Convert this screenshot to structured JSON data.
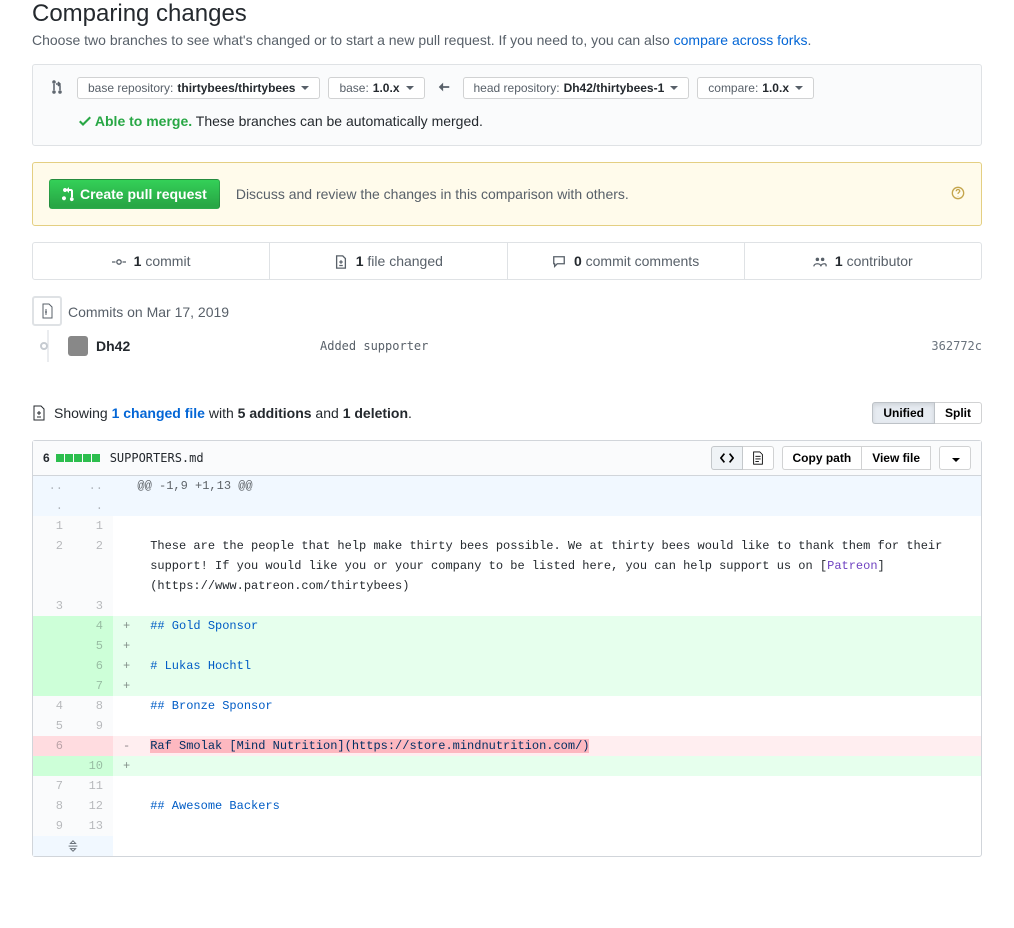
{
  "page": {
    "title": "Comparing changes",
    "subtitle_pre": "Choose two branches to see what's changed or to start a new pull request. If you need to, you can also ",
    "subtitle_link": "compare across forks",
    "subtitle_post": "."
  },
  "range": {
    "base_repo_label": "base repository: ",
    "base_repo": "thirtybees/thirtybees",
    "base_label": "base: ",
    "base_branch": "1.0.x",
    "head_repo_label": "head repository: ",
    "head_repo": "Dh42/thirtybees-1",
    "compare_label": "compare: ",
    "compare_branch": "1.0.x",
    "merge_ok": "Able to merge.",
    "merge_msg": " These branches can be automatically merged."
  },
  "pr": {
    "button": "Create pull request",
    "text": "Discuss and review the changes in this comparison with others."
  },
  "stats": {
    "commits_n": "1",
    "commits_label": " commit",
    "files_n": "1",
    "files_label": " file changed",
    "comments_n": "0",
    "comments_label": " commit comments",
    "contrib_n": "1",
    "contrib_label": " contributor"
  },
  "timeline": {
    "header": "Commits on Mar 17, 2019",
    "author": "Dh42",
    "message": "Added supporter",
    "sha": "362772c"
  },
  "diff_summary": {
    "showing": "Showing ",
    "files_link": "1 changed file",
    "with": " with ",
    "adds": "5 additions",
    "and": " and ",
    "dels": "1 deletion",
    "period": ".",
    "unified": "Unified",
    "split": "Split"
  },
  "file": {
    "changes": "6",
    "name": "SUPPORTERS.md",
    "copy_path": "Copy path",
    "view_file": "View file"
  },
  "hunk": "@@ -1,9 +1,13 @@",
  "lines": [
    {
      "old": "1",
      "new": "1",
      "m": " ",
      "t": ""
    },
    {
      "old": "2",
      "new": "2",
      "m": " ",
      "t": "These are the people that help make thirty bees possible. We at thirty bees would like to thank them for their support! If you would like you or your company to be listed here, you can help support us on [",
      "link": "Patreon",
      "t2": "](https://www.patreon.com/thirtybees)"
    },
    {
      "old": "3",
      "new": "3",
      "m": " ",
      "t": ""
    },
    {
      "old": "",
      "new": "4",
      "m": "+",
      "cls": "add",
      "h": "## Gold Sponsor"
    },
    {
      "old": "",
      "new": "5",
      "m": "+",
      "cls": "add",
      "t": ""
    },
    {
      "old": "",
      "new": "6",
      "m": "+",
      "cls": "add",
      "h": "# Lukas Hochtl"
    },
    {
      "old": "",
      "new": "7",
      "m": "+",
      "cls": "add",
      "t": ""
    },
    {
      "old": "4",
      "new": "8",
      "m": " ",
      "h": "## Bronze Sponsor"
    },
    {
      "old": "5",
      "new": "9",
      "m": " ",
      "t": ""
    },
    {
      "old": "6",
      "new": "",
      "m": "-",
      "cls": "del",
      "red": "Raf Smolak [Mind Nutrition](https://store.mindnutrition.com/)"
    },
    {
      "old": "",
      "new": "10",
      "m": "+",
      "cls": "add",
      "t": ""
    },
    {
      "old": "7",
      "new": "11",
      "m": " ",
      "t": ""
    },
    {
      "old": "8",
      "new": "12",
      "m": " ",
      "h": "## Awesome Backers"
    },
    {
      "old": "9",
      "new": "13",
      "m": " ",
      "t": ""
    }
  ]
}
